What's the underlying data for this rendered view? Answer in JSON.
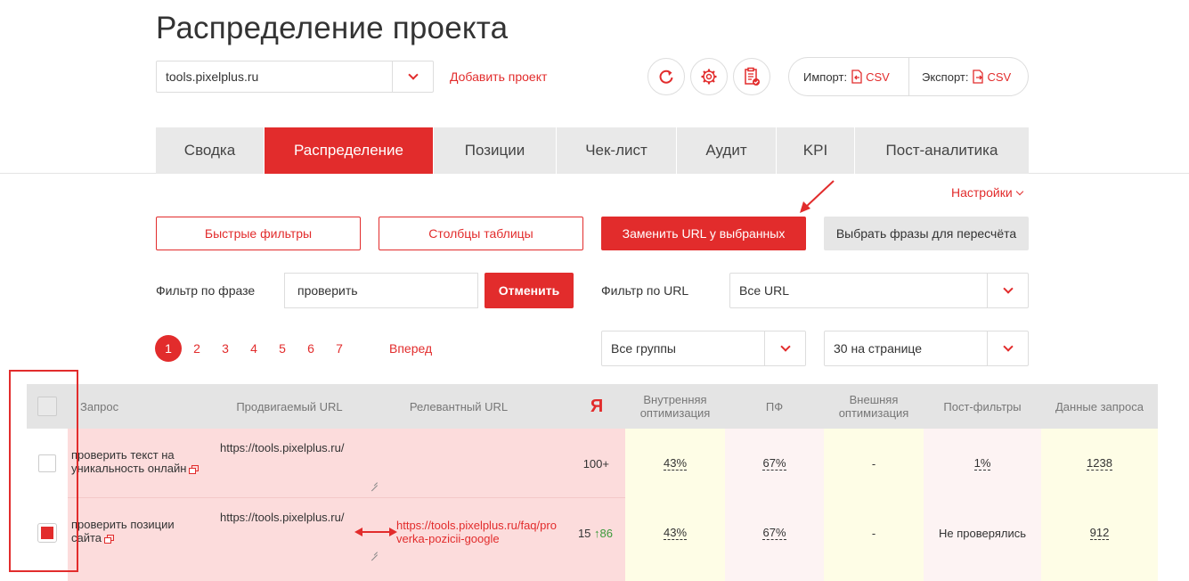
{
  "header": {
    "title": "Распределение проекта",
    "project_select": "tools.pixelplus.ru",
    "add_project": "Добавить проект",
    "import_label": "Импорт:",
    "import_format": "CSV",
    "export_label": "Экспорт:",
    "export_format": "CSV"
  },
  "tabs": [
    {
      "label": "Сводка",
      "active": false
    },
    {
      "label": "Распределение",
      "active": true
    },
    {
      "label": "Позиции",
      "active": false
    },
    {
      "label": "Чек-лист",
      "active": false
    },
    {
      "label": "Аудит",
      "active": false
    },
    {
      "label": "KPI",
      "active": false
    },
    {
      "label": "Пост-аналитика",
      "active": false
    }
  ],
  "settings_link": "Настройки",
  "toolbar": {
    "quick_filters": "Быстрые фильтры",
    "table_columns": "Столбцы таблицы",
    "replace_url": "Заменить URL у выбранных",
    "pick_phrases": "Выбрать фразы для пересчёта"
  },
  "filters": {
    "phrase_label": "Фильтр по фразе",
    "phrase_value": "проверить",
    "cancel": "Отменить",
    "url_label": "Фильтр по URL",
    "url_value": "Все URL",
    "groups_value": "Все группы",
    "per_page_value": "30 на странице"
  },
  "pagination": {
    "pages": [
      "1",
      "2",
      "3",
      "4",
      "5",
      "6",
      "7"
    ],
    "current": "1",
    "next": "Вперед"
  },
  "table": {
    "headers": {
      "query": "Запрос",
      "promoted_url": "Продвигаемый URL",
      "relevant_url": "Релевантный URL",
      "yandex": "Я",
      "internal_opt": "Внутренняя оптимизация",
      "pf": "ПФ",
      "external_opt": "Внешняя оптимизация",
      "post_filters": "Пост-фильтры",
      "query_data": "Данные запроса"
    },
    "rows": [
      {
        "checked": false,
        "query": "проверить текст на уникальность онлайн",
        "promoted_url": "https://tools.pixelplus.ru/",
        "relevant_url": "",
        "position": "100+",
        "position_change": "",
        "internal": "43%",
        "pf": "67%",
        "external": "-",
        "post_filters": "1%",
        "query_data": "1238"
      },
      {
        "checked": true,
        "query": "проверить позиции сайта",
        "promoted_url": "https://tools.pixelplus.ru/",
        "relevant_url": "https://tools.pixelplus.ru/faq/proverka-pozicii-google",
        "position": "15",
        "position_change": "↑86",
        "internal": "43%",
        "pf": "67%",
        "external": "-",
        "post_filters": "Не проверялись",
        "query_data": "912"
      }
    ]
  },
  "colors": {
    "accent": "#e22c2c",
    "row_pink": "#fcdcdc",
    "col_yellow": "#fefde6",
    "col_pink_light": "#fdf3f3",
    "up_green": "#3a9a3a"
  }
}
